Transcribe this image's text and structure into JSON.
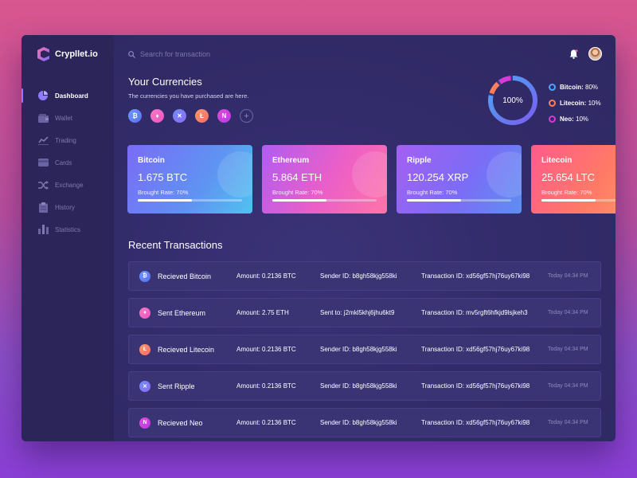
{
  "app": {
    "name": "Crypllet.io"
  },
  "colors": {
    "accent": "#8d7cff",
    "bitcoin": "#5b8cf0",
    "ethereum": "#f068b6",
    "ripple": "#6b7cf0",
    "litecoin": "#f7775a",
    "neo": "#d53bd6"
  },
  "sidebar": {
    "items": [
      {
        "label": "Dashboard",
        "icon": "pie-chart-icon"
      },
      {
        "label": "Wallet",
        "icon": "wallet-icon"
      },
      {
        "label": "Trading",
        "icon": "trend-icon"
      },
      {
        "label": "Cards",
        "icon": "card-icon"
      },
      {
        "label": "Exchange",
        "icon": "shuffle-icon"
      },
      {
        "label": "History",
        "icon": "clipboard-icon"
      },
      {
        "label": "Statistics",
        "icon": "bar-chart-icon"
      }
    ]
  },
  "header": {
    "search_placeholder": "Search for transaction"
  },
  "currencies": {
    "title": "Your Currencies",
    "subtitle": "The currencies you have purchased are here.",
    "donut_label": "100%",
    "shares": [
      80,
      10,
      10
    ],
    "legend": [
      {
        "name": "Bitcoin:",
        "value": "80%",
        "color": "#4fa6ff"
      },
      {
        "name": "Litecoin:",
        "value": "10%",
        "color": "#ff7f5a"
      },
      {
        "name": "Neo:",
        "value": "10%",
        "color": "#d53bd6"
      }
    ],
    "cards": [
      {
        "name": "Bitcoin",
        "amount": "1.675 BTC",
        "rate_label": "Brought Rate: 70%",
        "rate": 0.52
      },
      {
        "name": "Ethereum",
        "amount": "5.864 ETH",
        "rate_label": "Brought Rate: 70%",
        "rate": 0.52
      },
      {
        "name": "Ripple",
        "amount": "120.254 XRP",
        "rate_label": "Brought Rate: 70%",
        "rate": 0.52
      },
      {
        "name": "Litecoin",
        "amount": "25.654 LTC",
        "rate_label": "Brought Rate: 70%",
        "rate": 0.52
      }
    ]
  },
  "recent": {
    "title": "Recent Transactions",
    "rows": [
      {
        "name": "Recieved Bitcoin",
        "amount": "Amount: 0.2136 BTC",
        "party": "Sender ID: b8gh58kjg558ki",
        "txid": "Transaction ID: xd56gf57hj76uy67ki98",
        "time": "Today 04:34 PM"
      },
      {
        "name": "Sent Ethereum",
        "amount": "Amount: 2.75 ETH",
        "party": "Sent to: j2mkl5khj6jhu6kt9",
        "txid": "Transaction ID: mv5rgft6hfkjd9lsjkeh3",
        "time": "Today 04:34 PM"
      },
      {
        "name": "Recieved Litecoin",
        "amount": "Amount: 0.2136 BTC",
        "party": "Sender ID: b8gh58kjg558ki",
        "txid": "Transaction ID: xd56gf57hj76uy67ki98",
        "time": "Today 04:34 PM"
      },
      {
        "name": "Sent Ripple",
        "amount": "Amount: 0.2136 BTC",
        "party": "Sender ID: b8gh58kjg558ki",
        "txid": "Transaction ID: xd56gf57hj76uy67ki98",
        "time": "Today 04:34 PM"
      },
      {
        "name": "Recieved Neo",
        "amount": "Amount: 0.2136 BTC",
        "party": "Sender ID: b8gh58kjg558ki",
        "txid": "Transaction ID: xd56gf57hj76uy67ki98",
        "time": "Today 04:34 PM"
      }
    ]
  }
}
